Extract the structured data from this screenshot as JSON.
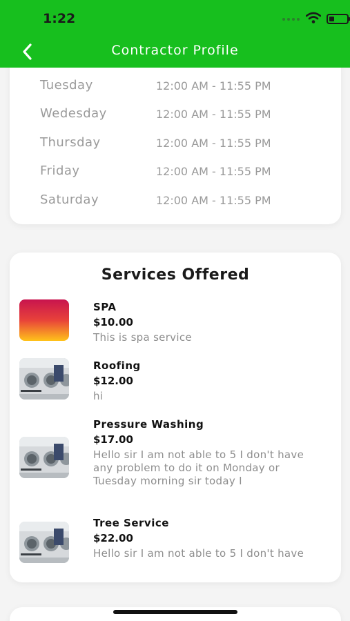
{
  "status_bar": {
    "time": "1:22"
  },
  "header": {
    "title": "Contractor Profile",
    "back_icon": "chevron-left-icon"
  },
  "colors": {
    "header_bg": "#17bf1e",
    "muted_text": "#9a9a9a",
    "card_bg": "#ffffff"
  },
  "hours": [
    {
      "day": "Tuesday",
      "time": "12:00 AM - 11:55 PM"
    },
    {
      "day": "Wedesday",
      "time": "12:00 AM - 11:55 PM"
    },
    {
      "day": "Thursday",
      "time": "12:00 AM - 11:55 PM"
    },
    {
      "day": "Friday",
      "time": "12:00 AM - 11:55 PM"
    },
    {
      "day": "Saturday",
      "time": "12:00 AM - 11:55 PM"
    }
  ],
  "services": {
    "title": "Services Offered",
    "items": [
      {
        "name": "SPA",
        "price": "$10.00",
        "description": "This is spa service"
      },
      {
        "name": "Roofing",
        "price": "$12.00",
        "description": "hi"
      },
      {
        "name": "Pressure Washing",
        "price": "$17.00",
        "description": "Hello sir I am not able to 5 I don't have any problem to do it on Monday or Tuesday morning sir today I"
      },
      {
        "name": "Tree Service",
        "price": "$22.00",
        "description": "Hello sir I am not able to 5 I don't have"
      }
    ]
  }
}
